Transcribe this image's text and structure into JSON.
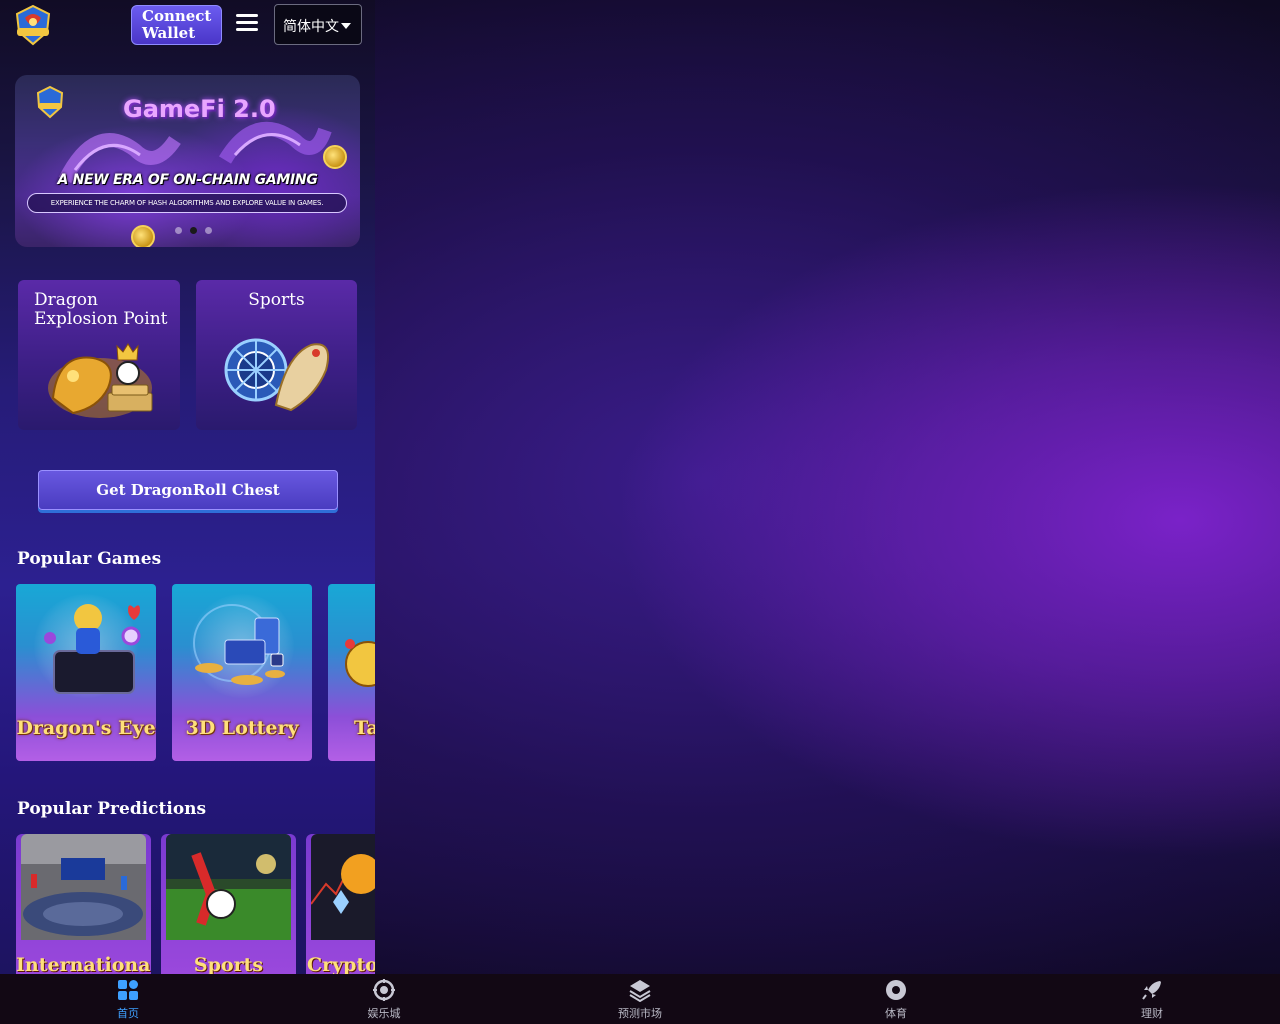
{
  "header": {
    "logo_icon": "dragon-shield-logo",
    "connect_label": "Connect Wallet",
    "menu_icon": "hamburger-menu-icon",
    "language": "简体中文"
  },
  "banner": {
    "title": "GameFi 2.0",
    "subtitle": "A NEW ERA OF ON-CHAIN GAMING",
    "tagline": "EXPERIENCE THE CHARM OF HASH ALGORITHMS AND EXPLORE VALUE IN GAMES.",
    "slides": 3,
    "active_slide": 2
  },
  "categories": [
    {
      "label": "Dragon Explosion Point",
      "icon": "golden-dragon-icon"
    },
    {
      "label": "Sports",
      "icon": "sports-dragon-icon"
    }
  ],
  "chest_button": "Get DragonRoll Chest",
  "popular_games": {
    "title": "Popular Games",
    "items": [
      "Dragon's Eye",
      "3D Lottery",
      "Ta"
    ]
  },
  "popular_predictions": {
    "title": "Popular Predictions",
    "items": [
      "International",
      "Sports",
      "Crypto"
    ]
  },
  "bottom_nav": [
    {
      "label": "首页",
      "icon": "home-grid-icon",
      "active": true
    },
    {
      "label": "娱乐城",
      "icon": "casino-chip-icon",
      "active": false
    },
    {
      "label": "预测市场",
      "icon": "layers-icon",
      "active": false
    },
    {
      "label": "体育",
      "icon": "ball-icon",
      "active": false
    },
    {
      "label": "理财",
      "icon": "rocket-icon",
      "active": false
    }
  ],
  "colors": {
    "accent": "#3ea0ff",
    "button": "#4a36c8",
    "gold_text": "#ffe07a",
    "card_purple": "#5a2aa8"
  }
}
